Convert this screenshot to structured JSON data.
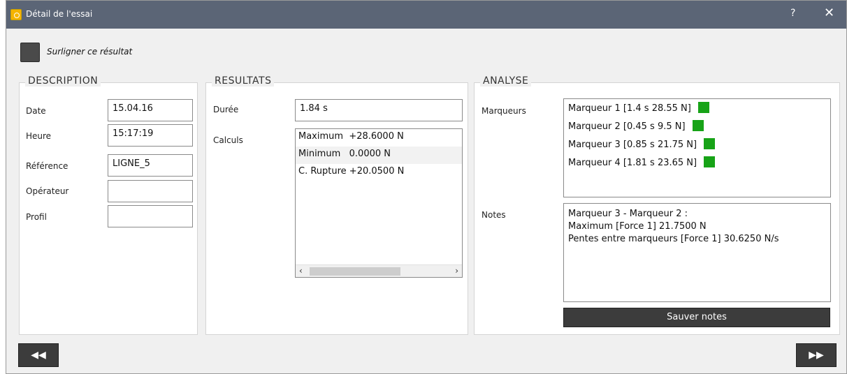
{
  "window": {
    "title": "Détail de l'essai",
    "help_label": "?",
    "close_label": "✕"
  },
  "highlight": {
    "label": "Surligner ce résultat"
  },
  "description": {
    "title": "DESCRIPTION",
    "date_label": "Date",
    "date_value": "15.04.16",
    "heure_label": "Heure",
    "heure_value": "15:17:19",
    "reference_label": "Référence",
    "reference_value": "LIGNE_5",
    "operateur_label": "Opérateur",
    "operateur_value": "",
    "profil_label": "Profil",
    "profil_value": ""
  },
  "resultats": {
    "title": "RESULTATS",
    "duree_label": "Durée",
    "duree_value": "1.84 s",
    "calculs_label": "Calculs",
    "calculs": [
      "Maximum  +28.6000 N",
      "Minimum   0.0000 N",
      "C. Rupture +20.0500 N"
    ],
    "scroll_left": "‹",
    "scroll_right": "›"
  },
  "analyse": {
    "title": "ANALYSE",
    "marqueurs_label": "Marqueurs",
    "marqueurs": [
      "Marqueur 1  [1.4 s 28.55 N]",
      "Marqueur 2  [0.45 s 9.5 N]",
      "Marqueur 3  [0.85 s 21.75 N]",
      "Marqueur 4  [1.81 s 23.65 N]"
    ],
    "marker_color": "#17a317",
    "notes_label": "Notes",
    "notes_lines": [
      "Marqueur 3 - Marqueur 2 :",
      "Maximum [Force 1] 21.7500 N",
      "Pentes entre marqueurs [Force 1] 30.6250 N/s"
    ],
    "save_label": "Sauver notes"
  },
  "nav": {
    "prev_label": "◀◀",
    "next_label": "▶▶"
  }
}
